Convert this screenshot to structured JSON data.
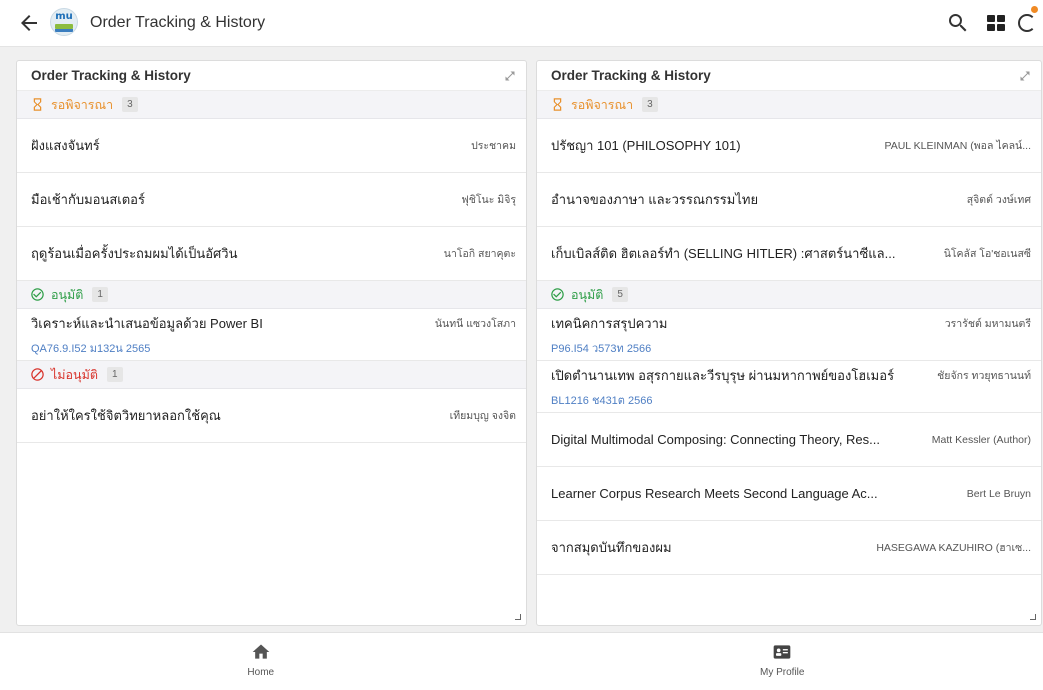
{
  "app": {
    "title": "Order Tracking & History",
    "logo_text": "mu",
    "back_icon": "arrow-back-icon",
    "actions": [
      "search-icon",
      "grid-icon",
      "sync-icon"
    ],
    "badge_color": "#f08a24"
  },
  "call_number_color": "#4f7fc4",
  "panels": [
    {
      "title": "Order Tracking & History",
      "sections": [
        {
          "label": "รอพิจารณา",
          "count": "3",
          "icon": "hourglass-icon",
          "color": "#e8912d",
          "items": [
            {
              "title": "ฝังแสงจันทร์",
              "author": "ประชาคม"
            },
            {
              "title": "มือเช้ากับมอนสเตอร์",
              "author": "ฟุชิโนะ มิจิรุ"
            },
            {
              "title": "ฤดูร้อนเมื่อครั้งประถมผมได้เป็นอัศวิน",
              "author": "นาโอกิ สยาคุตะ"
            }
          ]
        },
        {
          "label": "อนุมัติ",
          "count": "1",
          "icon": "check-circle-icon",
          "color": "#2f9e48",
          "items": [
            {
              "title": "วิเคราะห์และนำเสนอข้อมูลด้วย Power BI",
              "author": "นันทนี แซวงโสภา",
              "call_number": "QA76.9.I52 ม132น 2565"
            }
          ]
        },
        {
          "label": "ไม่อนุมัติ",
          "count": "1",
          "icon": "block-icon",
          "color": "#d8342c",
          "items": [
            {
              "title": "อย่าให้ใครใช้จิตวิทยาหลอกใช้คุณ",
              "author": "เทียมบุญ จงจิต"
            }
          ]
        }
      ]
    },
    {
      "title": "Order Tracking & History",
      "sections": [
        {
          "label": "รอพิจารณา",
          "count": "3",
          "icon": "hourglass-icon",
          "color": "#e8912d",
          "items": [
            {
              "title": "ปรัชญา 101 (PHILOSOPHY 101)",
              "author": "PAUL KLEINMAN (พอล ไคลน์..."
            },
            {
              "title": "อำนาจของภาษา และวรรณกรรมไทย",
              "author": "สุจิตต์ วงษ์เทศ"
            },
            {
              "title": "เก็บเบิลส์ติด ฮิตเลอร์ทำ (SELLING HITLER) :ศาสตร์นาซีแล...",
              "author": "นิโคลัส โอ'ชอเนสซี"
            }
          ]
        },
        {
          "label": "อนุมัติ",
          "count": "5",
          "icon": "check-circle-icon",
          "color": "#2f9e48",
          "items": [
            {
              "title": "เทคนิคการสรุปความ",
              "author": "วรารัชต์ มหามนตรี",
              "call_number": "P96.I54 ว573ท 2566"
            },
            {
              "title": "เปิดตำนานเทพ อสุรกายและวีรบุรุษ ผ่านมหากาพย์ของโฮเมอร์",
              "author": "ชัยจักร ทวยุทธานนท์",
              "call_number": "BL1216 ช431ต 2566"
            },
            {
              "title": "Digital Multimodal Composing: Connecting Theory, Res...",
              "author": "Matt Kessler (Author)"
            },
            {
              "title": "Learner Corpus Research Meets Second Language Ac...",
              "author": "Bert Le Bruyn"
            },
            {
              "title": "จากสมุดบันทึกของผม",
              "author": "HASEGAWA KAZUHIRO (ฮาเซ..."
            }
          ]
        }
      ]
    }
  ],
  "bottom_nav": [
    {
      "label": "Home",
      "icon": "home-icon"
    },
    {
      "label": "My Profile",
      "icon": "profile-card-icon"
    }
  ]
}
